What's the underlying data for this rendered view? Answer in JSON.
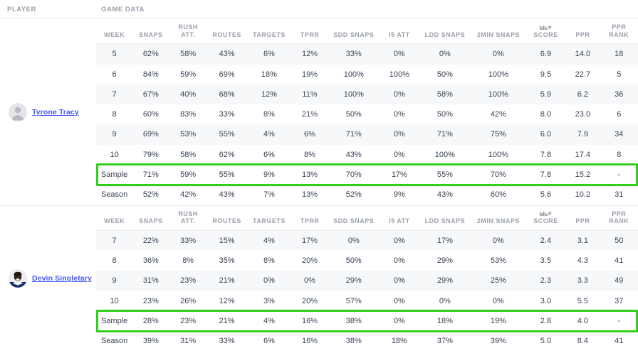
{
  "header": {
    "player_label": "PLAYER",
    "game_data_label": "GAME DATA"
  },
  "columns": [
    {
      "key": "week",
      "label": "WEEK",
      "line2": ""
    },
    {
      "key": "snaps",
      "label": "SNAPS",
      "line2": ""
    },
    {
      "key": "rush_att",
      "label": "RUSH",
      "line2": "ATT."
    },
    {
      "key": "routes",
      "label": "ROUTES",
      "line2": ""
    },
    {
      "key": "targets",
      "label": "TARGETS",
      "line2": ""
    },
    {
      "key": "tprr",
      "label": "TPRR",
      "line2": ""
    },
    {
      "key": "sdd",
      "label": "SDD SNAPS",
      "line2": ""
    },
    {
      "key": "i5",
      "label": "I5 ATT",
      "line2": ""
    },
    {
      "key": "ldd",
      "label": "LDD SNAPS",
      "line2": ""
    },
    {
      "key": "min2",
      "label": "2MIN SNAPS",
      "line2": ""
    },
    {
      "key": "score",
      "label": "SCORE",
      "line2": "",
      "icon": "pff-star-logo-icon"
    },
    {
      "key": "ppr",
      "label": "PPR",
      "line2": ""
    },
    {
      "key": "ppr_rank",
      "label": "PPR",
      "line2": "RANK"
    }
  ],
  "colors": {
    "highlight_green": "#2ed01a",
    "link_blue": "#4759f5",
    "header_grey": "#9aa0ab",
    "row_stripe": "#f7f8f9",
    "text": "#384256"
  },
  "players": [
    {
      "name": "Tyrone Tracy",
      "avatar": "placeholder-avatar",
      "rows": [
        {
          "week": "5",
          "snaps": "62%",
          "rush_att": "58%",
          "routes": "43%",
          "targets": "6%",
          "tprr": "12%",
          "sdd": "33%",
          "i5": "0%",
          "ldd": "0%",
          "min2": "0%",
          "score": "6.9",
          "ppr": "14.0",
          "ppr_rank": "18",
          "highlight": false
        },
        {
          "week": "6",
          "snaps": "84%",
          "rush_att": "59%",
          "routes": "69%",
          "targets": "18%",
          "tprr": "19%",
          "sdd": "100%",
          "i5": "100%",
          "ldd": "50%",
          "min2": "100%",
          "score": "9.5",
          "ppr": "22.7",
          "ppr_rank": "5",
          "highlight": false
        },
        {
          "week": "7",
          "snaps": "67%",
          "rush_att": "40%",
          "routes": "68%",
          "targets": "12%",
          "tprr": "11%",
          "sdd": "100%",
          "i5": "0%",
          "ldd": "58%",
          "min2": "100%",
          "score": "5.9",
          "ppr": "6.2",
          "ppr_rank": "36",
          "highlight": false
        },
        {
          "week": "8",
          "snaps": "60%",
          "rush_att": "83%",
          "routes": "33%",
          "targets": "8%",
          "tprr": "21%",
          "sdd": "50%",
          "i5": "0%",
          "ldd": "50%",
          "min2": "42%",
          "score": "8.0",
          "ppr": "23.0",
          "ppr_rank": "6",
          "highlight": false
        },
        {
          "week": "9",
          "snaps": "69%",
          "rush_att": "53%",
          "routes": "55%",
          "targets": "4%",
          "tprr": "6%",
          "sdd": "71%",
          "i5": "0%",
          "ldd": "71%",
          "min2": "75%",
          "score": "6.0",
          "ppr": "7.9",
          "ppr_rank": "34",
          "highlight": false
        },
        {
          "week": "10",
          "snaps": "79%",
          "rush_att": "58%",
          "routes": "62%",
          "targets": "6%",
          "tprr": "8%",
          "sdd": "43%",
          "i5": "0%",
          "ldd": "100%",
          "min2": "100%",
          "score": "7.8",
          "ppr": "17.4",
          "ppr_rank": "8",
          "highlight": false
        },
        {
          "week": "Sample",
          "snaps": "71%",
          "rush_att": "59%",
          "routes": "55%",
          "targets": "9%",
          "tprr": "13%",
          "sdd": "70%",
          "i5": "17%",
          "ldd": "55%",
          "min2": "70%",
          "score": "7.8",
          "ppr": "15.2",
          "ppr_rank": "-",
          "highlight": true
        },
        {
          "week": "Season",
          "snaps": "52%",
          "rush_att": "42%",
          "routes": "43%",
          "targets": "7%",
          "tprr": "13%",
          "sdd": "52%",
          "i5": "9%",
          "ldd": "43%",
          "min2": "60%",
          "score": "5.6",
          "ppr": "10.2",
          "ppr_rank": "31",
          "highlight": false
        }
      ]
    },
    {
      "name": "Devin Singletary",
      "avatar": "photo-avatar",
      "rows": [
        {
          "week": "7",
          "snaps": "22%",
          "rush_att": "33%",
          "routes": "15%",
          "targets": "4%",
          "tprr": "17%",
          "sdd": "0%",
          "i5": "0%",
          "ldd": "17%",
          "min2": "0%",
          "score": "2.4",
          "ppr": "3.1",
          "ppr_rank": "50",
          "highlight": false
        },
        {
          "week": "8",
          "snaps": "36%",
          "rush_att": "8%",
          "routes": "35%",
          "targets": "8%",
          "tprr": "20%",
          "sdd": "50%",
          "i5": "0%",
          "ldd": "29%",
          "min2": "53%",
          "score": "3.5",
          "ppr": "4.3",
          "ppr_rank": "41",
          "highlight": false
        },
        {
          "week": "9",
          "snaps": "31%",
          "rush_att": "23%",
          "routes": "21%",
          "targets": "0%",
          "tprr": "0%",
          "sdd": "29%",
          "i5": "0%",
          "ldd": "29%",
          "min2": "25%",
          "score": "2.3",
          "ppr": "3.3",
          "ppr_rank": "49",
          "highlight": false
        },
        {
          "week": "10",
          "snaps": "23%",
          "rush_att": "26%",
          "routes": "12%",
          "targets": "3%",
          "tprr": "20%",
          "sdd": "57%",
          "i5": "0%",
          "ldd": "0%",
          "min2": "0%",
          "score": "3.0",
          "ppr": "5.5",
          "ppr_rank": "37",
          "highlight": false
        },
        {
          "week": "Sample",
          "snaps": "28%",
          "rush_att": "23%",
          "routes": "21%",
          "targets": "4%",
          "tprr": "16%",
          "sdd": "38%",
          "i5": "0%",
          "ldd": "18%",
          "min2": "19%",
          "score": "2.8",
          "ppr": "4.0",
          "ppr_rank": "-",
          "highlight": true
        },
        {
          "week": "Season",
          "snaps": "39%",
          "rush_att": "31%",
          "routes": "33%",
          "targets": "6%",
          "tprr": "16%",
          "sdd": "38%",
          "i5": "18%",
          "ldd": "37%",
          "min2": "39%",
          "score": "5.0",
          "ppr": "8.4",
          "ppr_rank": "41",
          "highlight": false
        }
      ]
    }
  ]
}
